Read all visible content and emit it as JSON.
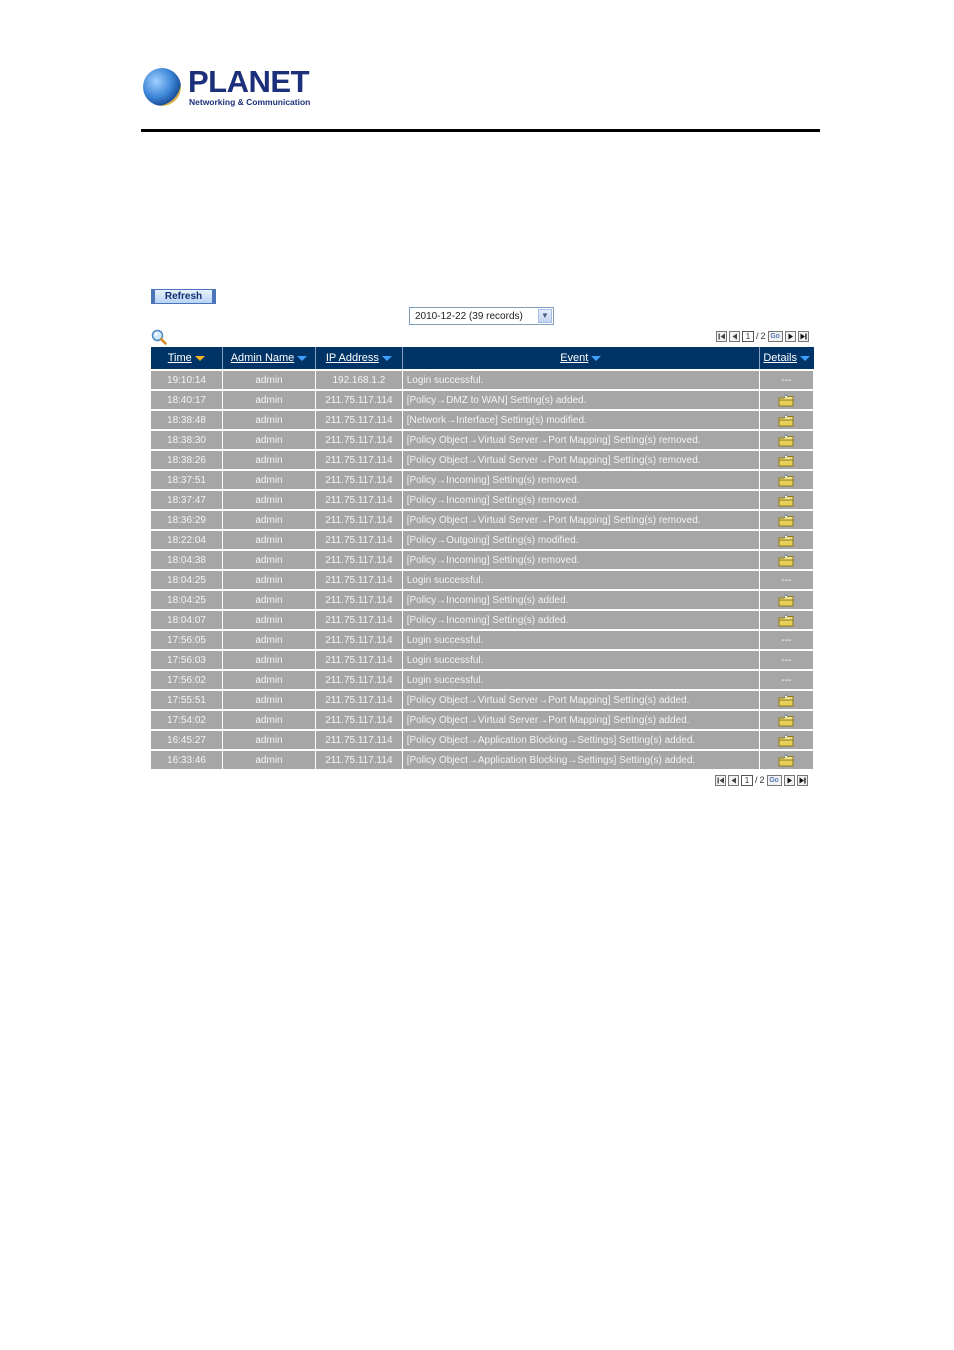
{
  "logo": {
    "brand": "PLANET",
    "tagline": "Networking & Communication"
  },
  "toolbar": {
    "refresh_label": "Refresh",
    "date_select_value": "2010-12-22 (39 records)",
    "search_icon": "magnifier-icon"
  },
  "pager": {
    "current_page": "1",
    "separator": "/",
    "total_pages": "2",
    "go_label": "Go",
    "icons": [
      "first-page-icon",
      "prev-page-icon",
      "next-page-icon",
      "last-page-icon"
    ]
  },
  "table": {
    "headers": [
      {
        "label": "Time",
        "sort": "active"
      },
      {
        "label": "Admin Name",
        "sort": "normal"
      },
      {
        "label": "IP Address",
        "sort": "normal"
      },
      {
        "label": "Event",
        "sort": "normal"
      },
      {
        "label": "Details",
        "sort": "normal"
      }
    ],
    "rows": [
      {
        "time": "19:10:14",
        "admin": "admin",
        "ip": "192.168.1.2",
        "event": "Login successful.",
        "details": "---"
      },
      {
        "time": "18:40:17",
        "admin": "admin",
        "ip": "211.75.117.114",
        "event": "[Policy→DMZ to WAN] Setting(s) added.",
        "details": "folder"
      },
      {
        "time": "18:38:48",
        "admin": "admin",
        "ip": "211.75.117.114",
        "event": "[Network→Interface] Setting(s) modified.",
        "details": "folder"
      },
      {
        "time": "18:38:30",
        "admin": "admin",
        "ip": "211.75.117.114",
        "event": "[Policy Object→Virtual Server→Port Mapping] Setting(s) removed.",
        "details": "folder"
      },
      {
        "time": "18:38:26",
        "admin": "admin",
        "ip": "211.75.117.114",
        "event": "[Policy Object→Virtual Server→Port Mapping] Setting(s) removed.",
        "details": "folder"
      },
      {
        "time": "18:37:51",
        "admin": "admin",
        "ip": "211.75.117.114",
        "event": "[Policy→Incoming] Setting(s) removed.",
        "details": "folder"
      },
      {
        "time": "18:37:47",
        "admin": "admin",
        "ip": "211.75.117.114",
        "event": "[Policy→Incoming] Setting(s) removed.",
        "details": "folder"
      },
      {
        "time": "18:36:29",
        "admin": "admin",
        "ip": "211.75.117.114",
        "event": "[Policy Object→Virtual Server→Port Mapping] Setting(s) removed.",
        "details": "folder"
      },
      {
        "time": "18:22:04",
        "admin": "admin",
        "ip": "211.75.117.114",
        "event": "[Policy→Outgoing] Setting(s) modified.",
        "details": "folder"
      },
      {
        "time": "18:04:38",
        "admin": "admin",
        "ip": "211.75.117.114",
        "event": "[Policy→Incoming] Setting(s) removed.",
        "details": "folder"
      },
      {
        "time": "18:04:25",
        "admin": "admin",
        "ip": "211.75.117.114",
        "event": "Login successful.",
        "details": "---"
      },
      {
        "time": "18:04:25",
        "admin": "admin",
        "ip": "211.75.117.114",
        "event": "[Policy→Incoming] Setting(s) added.",
        "details": "folder"
      },
      {
        "time": "18:04:07",
        "admin": "admin",
        "ip": "211.75.117.114",
        "event": "[Policy→Incoming] Setting(s) added.",
        "details": "folder"
      },
      {
        "time": "17:56:05",
        "admin": "admin",
        "ip": "211.75.117.114",
        "event": "Login successful.",
        "details": "---"
      },
      {
        "time": "17:56:03",
        "admin": "admin",
        "ip": "211.75.117.114",
        "event": "Login successful.",
        "details": "---"
      },
      {
        "time": "17:56:02",
        "admin": "admin",
        "ip": "211.75.117.114",
        "event": "Login successful.",
        "details": "---"
      },
      {
        "time": "17:55:51",
        "admin": "admin",
        "ip": "211.75.117.114",
        "event": "[Policy Object→Virtual Server→Port Mapping] Setting(s) added.",
        "details": "folder"
      },
      {
        "time": "17:54:02",
        "admin": "admin",
        "ip": "211.75.117.114",
        "event": "[Policy Object→Virtual Server→Port Mapping] Setting(s) added.",
        "details": "folder"
      },
      {
        "time": "16:45:27",
        "admin": "admin",
        "ip": "211.75.117.114",
        "event": "[Policy Object→Application Blocking→Settings] Setting(s) added.",
        "details": "folder"
      },
      {
        "time": "16:33:46",
        "admin": "admin",
        "ip": "211.75.117.114",
        "event": "[Policy Object→Application Blocking→Settings] Setting(s) added.",
        "details": "folder"
      }
    ]
  },
  "colors": {
    "header_bg": "#003366",
    "row_bg": "#a6a6a6",
    "sort_active": "#f3b32a",
    "sort_normal": "#3fa0ff"
  }
}
